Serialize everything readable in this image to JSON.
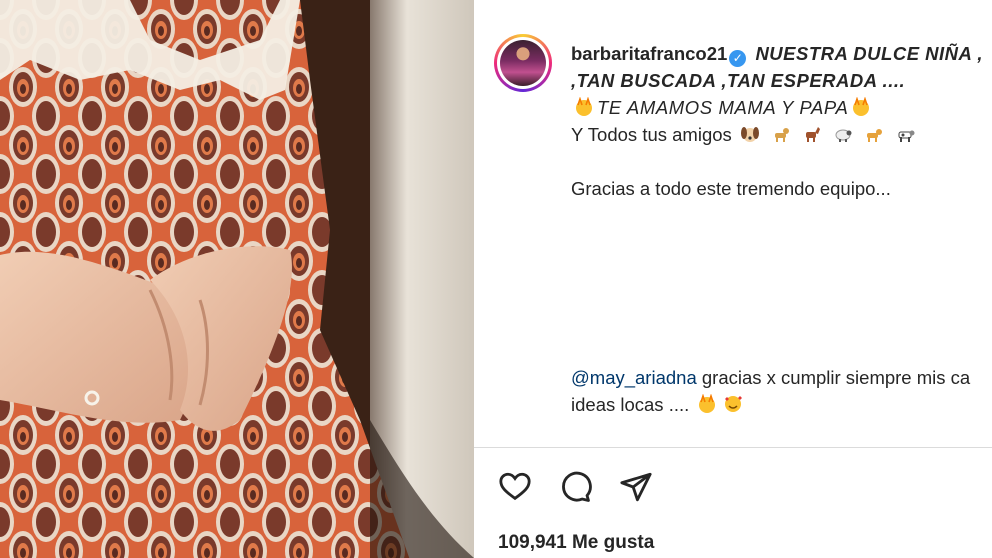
{
  "post": {
    "username": "barbaritafranco21",
    "caption_line1": "NUESTRA DULCE NIÑA ,",
    "caption_line2": ",TAN BUSCADA ,TAN ESPERADA ....",
    "caption_line3": "TE AMAMOS MAMA Y PAPA",
    "caption_line4": "Y Todos tus amigos",
    "caption_line5": "Gracias a todo este tremendo equipo...",
    "mention": "@may_ariadna",
    "mention_text": "gracias x cumplir siempre mis ca",
    "caption_last": "ideas locas ....",
    "likes": "109,941 Me gusta"
  },
  "icons": {
    "verified": "verified-badge-icon",
    "like": "heart-icon",
    "comment": "comment-icon",
    "share": "share-icon"
  },
  "colors": {
    "text": "#262626",
    "mention": "#00376b",
    "verified": "#3797f0",
    "divider": "#dbdbdb",
    "dress": "#d9623a"
  }
}
